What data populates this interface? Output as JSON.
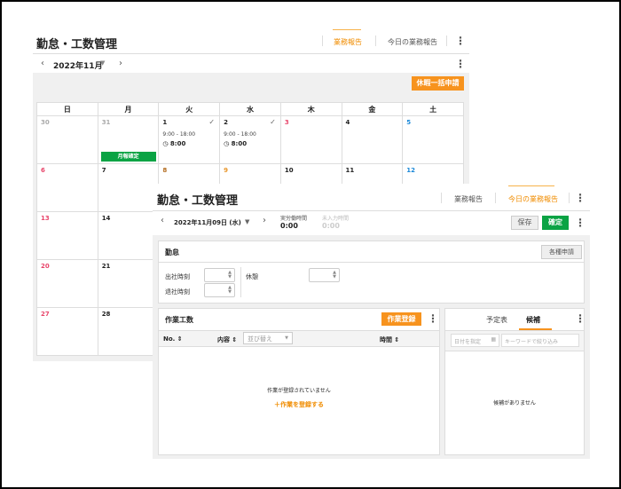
{
  "back": {
    "title": "勤怠・工数管理",
    "tabs": [
      {
        "label": "業務報告",
        "active": true
      },
      {
        "label": "今日の業務報告",
        "active": false
      }
    ],
    "month": "2022年11月",
    "bulk_leave_button": "休暇一括申請",
    "weekdays": [
      "日",
      "月",
      "火",
      "水",
      "木",
      "金",
      "土"
    ],
    "weeks": [
      [
        {
          "d": "30",
          "c": "gray"
        },
        {
          "d": "31",
          "c": "gray",
          "badge": "月報確定"
        },
        {
          "d": "1",
          "c": "",
          "check": true,
          "time": "9:00 - 18:00",
          "hours": "8:00"
        },
        {
          "d": "2",
          "c": "",
          "check": true,
          "time": "9:00 - 18:00",
          "hours": "8:00"
        },
        {
          "d": "3",
          "c": "red"
        },
        {
          "d": "4",
          "c": ""
        },
        {
          "d": "5",
          "c": "blue"
        }
      ],
      [
        {
          "d": "6",
          "c": "red"
        },
        {
          "d": "7",
          "c": ""
        },
        {
          "d": "8",
          "c": "brown"
        },
        {
          "d": "9",
          "c": "orange"
        },
        {
          "d": "10",
          "c": ""
        },
        {
          "d": "11",
          "c": ""
        },
        {
          "d": "12",
          "c": "blue"
        }
      ],
      [
        {
          "d": "13",
          "c": "red"
        },
        {
          "d": "14",
          "c": ""
        }
      ],
      [
        {
          "d": "20",
          "c": "red"
        },
        {
          "d": "21",
          "c": ""
        }
      ],
      [
        {
          "d": "27",
          "c": "red"
        },
        {
          "d": "28",
          "c": ""
        }
      ]
    ]
  },
  "front": {
    "title": "勤怠・工数管理",
    "tabs": [
      {
        "label": "業務報告",
        "active": false
      },
      {
        "label": "今日の業務報告",
        "active": true
      }
    ],
    "date": "2022年11月09日 (水)",
    "actual_label": "実労働時間",
    "actual_value": "0:00",
    "uninput_label": "未入力時間",
    "uninput_value": "0:00",
    "save": "保存",
    "confirm": "確定",
    "attendance": {
      "title": "勤怠",
      "apply": "各種申請",
      "start": "出社時刻",
      "end": "退社時刻",
      "break": "休憩"
    },
    "work": {
      "title": "作業工数",
      "register": "作業登録",
      "col_no": "No.",
      "col_content": "内容",
      "sort_placeholder": "並び替え",
      "col_time": "時間",
      "empty": "作業が登録されていません",
      "add": "作業を登録する"
    },
    "side": {
      "tabs": [
        "予定表",
        "候補"
      ],
      "active_tab": "候補",
      "date_placeholder": "日付を指定",
      "keyword_placeholder": "キーワードで絞り込み",
      "empty": "候補がありません"
    }
  },
  "colors": {
    "accent": "#f7931e",
    "green": "#0aa344",
    "red": "#e8456a",
    "blue": "#1a88d8"
  }
}
